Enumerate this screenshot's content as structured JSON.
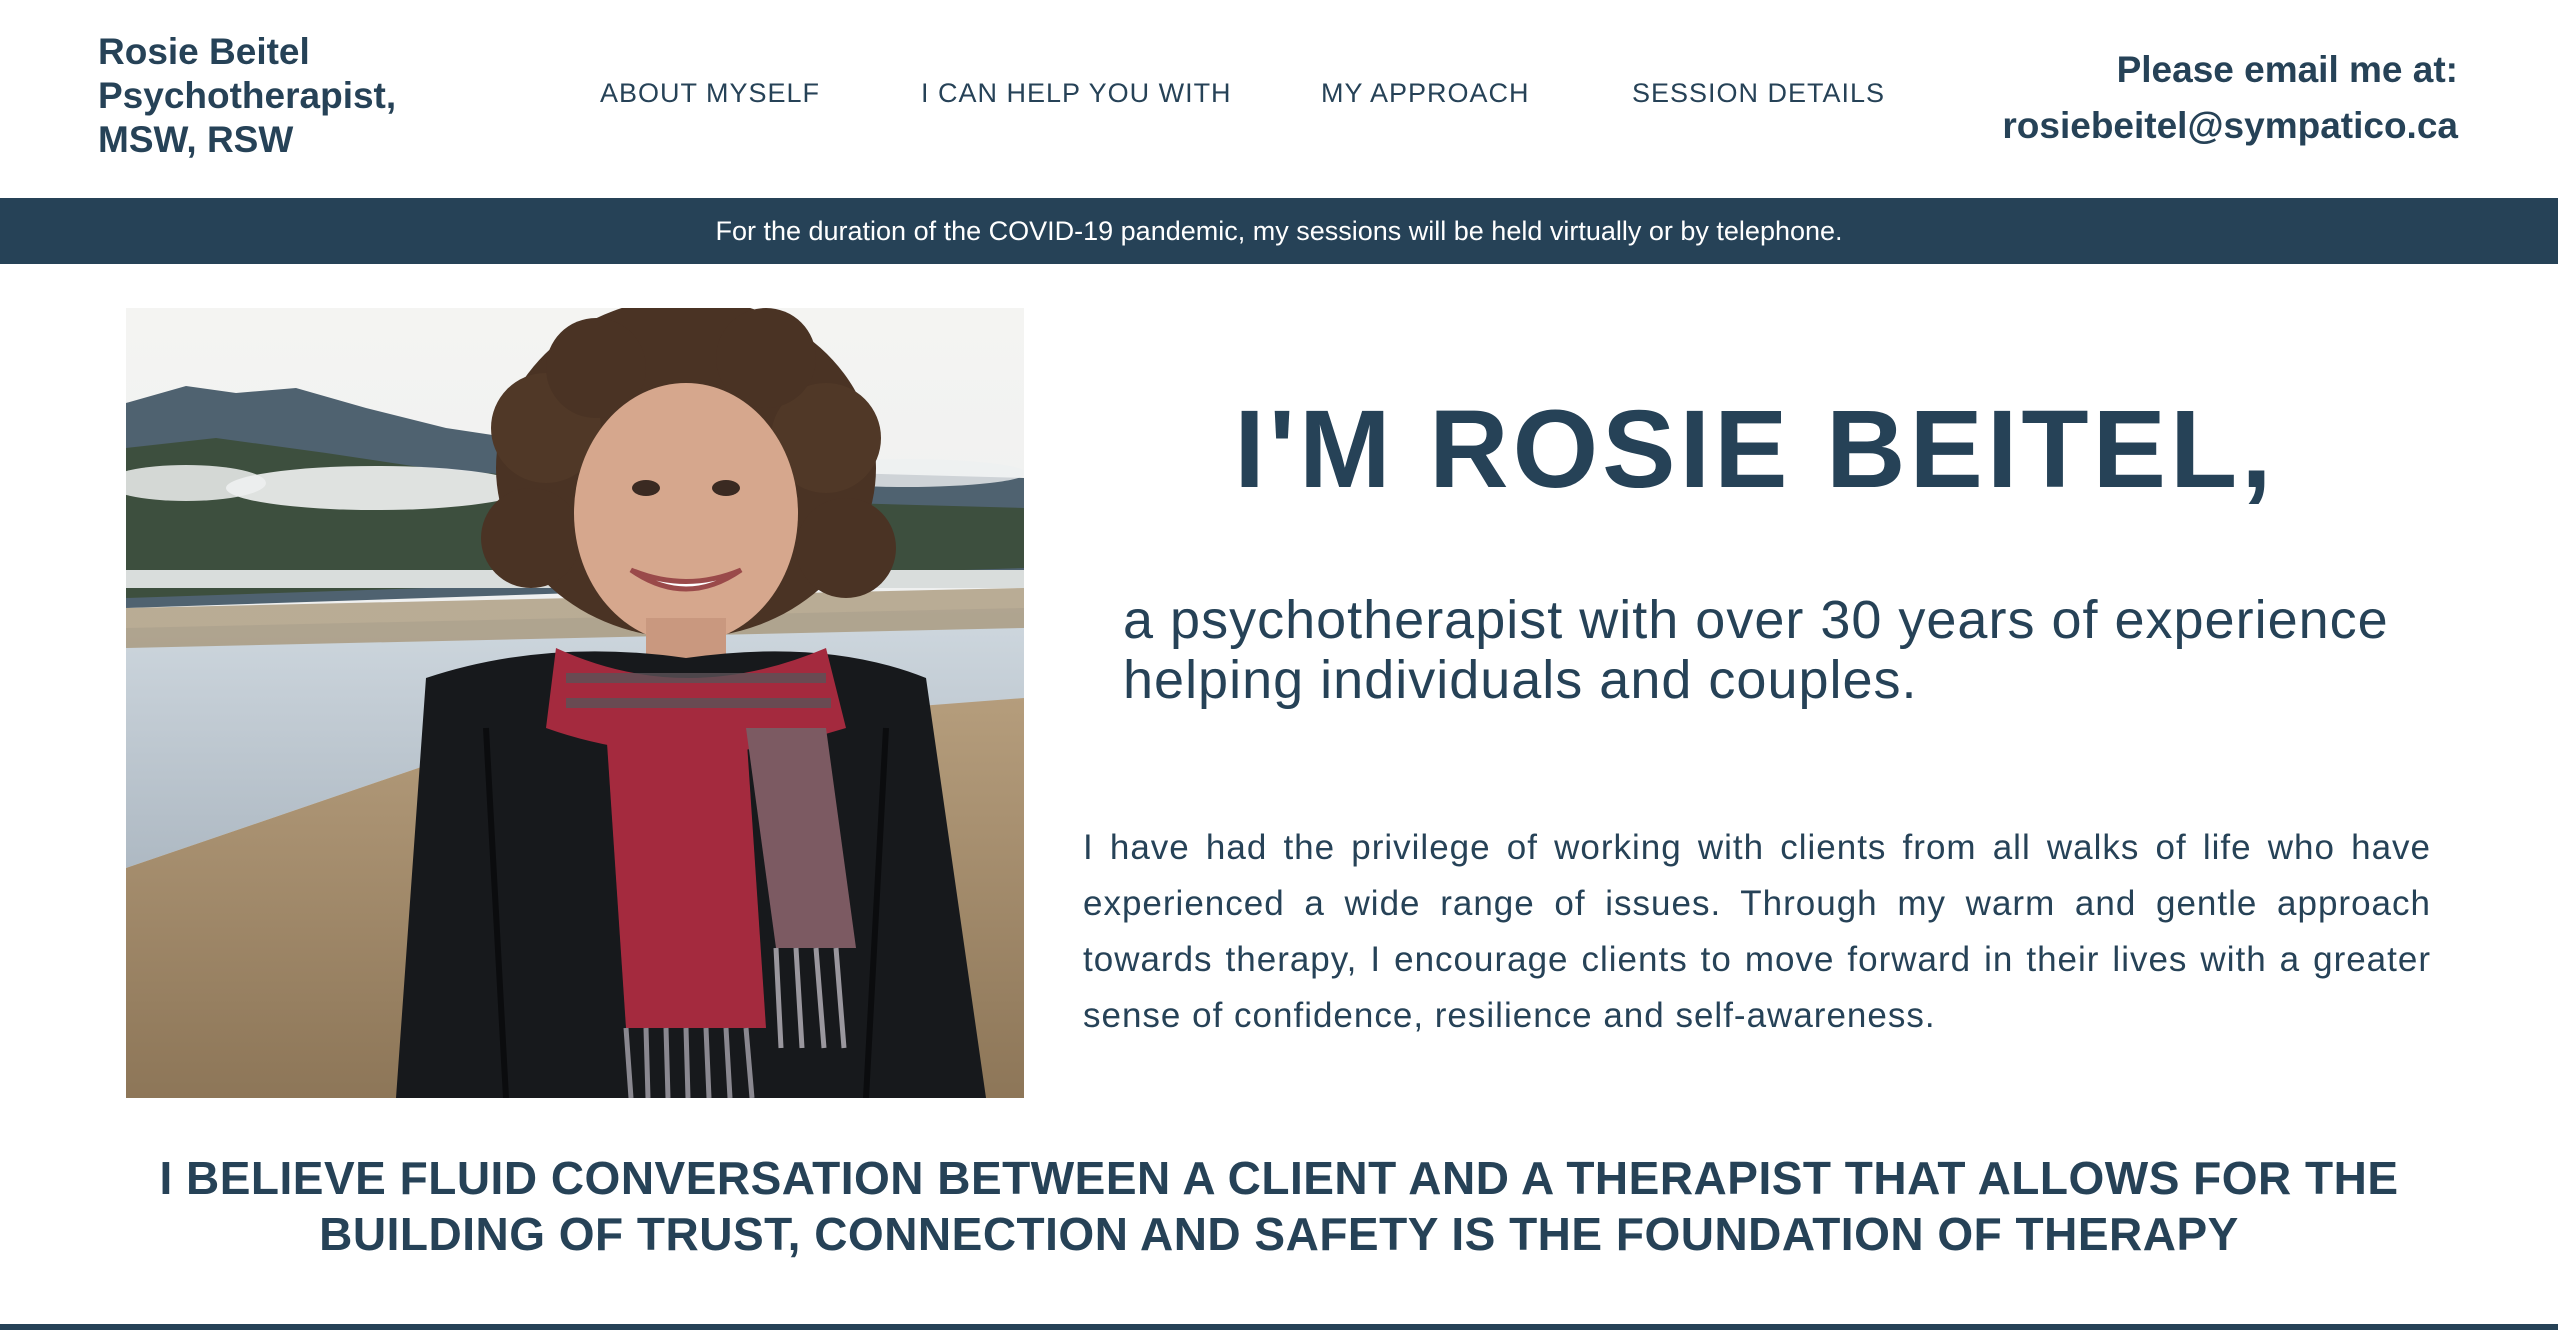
{
  "header": {
    "brand_lines": [
      "Rosie Beitel",
      "Psychotherapist,",
      "MSW, RSW"
    ],
    "nav": [
      {
        "label": "ABOUT MYSELF"
      },
      {
        "label": "I CAN HELP YOU WITH"
      },
      {
        "label": "MY APPROACH"
      },
      {
        "label": "SESSION DETAILS"
      }
    ],
    "contact_label": "Please email me at:",
    "contact_email": "rosiebeitel@sympatico.ca"
  },
  "banner": {
    "text": "For the duration of the COVID-19 pandemic, my sessions will be held virtually or by telephone."
  },
  "intro": {
    "heading": "I'M ROSIE BEITEL,",
    "subtitle": "a psychotherapist with over 30 years of experience helping individuals and couples.",
    "body": "I have had the privilege of working with clients from all walks of life who have experienced a wide range of issues. Through my warm and gentle approach towards therapy, I encourage clients to move forward in their lives with a greater sense of confidence, resilience and self-awareness."
  },
  "belief": {
    "text": "I BELIEVE FLUID CONVERSATION BETWEEN A CLIENT AND A THERAPIST THAT ALLOWS FOR THE BUILDING OF TRUST, CONNECTION AND SAFETY IS THE FOUNDATION OF THERAPY"
  },
  "colors": {
    "primary": "#264257",
    "background": "#ffffff",
    "banner_text": "#ffffff"
  }
}
